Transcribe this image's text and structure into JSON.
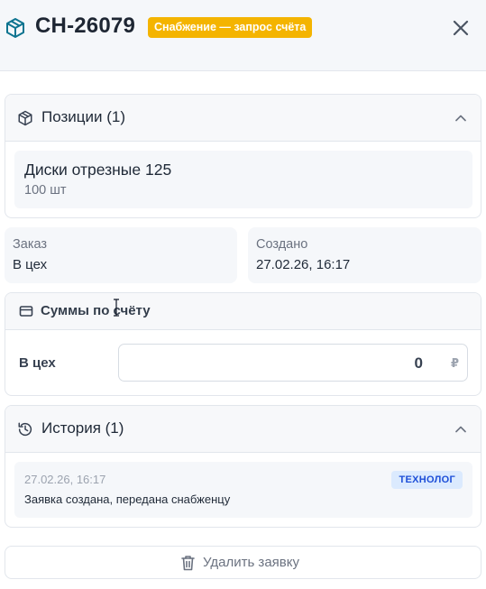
{
  "header": {
    "title": "СН-26079",
    "status_badge": "Снабжение — запрос счёта",
    "badge_color": "#f4b400",
    "icon": "box-icon",
    "close_icon": "close-icon"
  },
  "positions": {
    "title": "Позиции (1)",
    "items": [
      {
        "name": "Диски отрезные 125",
        "qty": "100 шт"
      }
    ]
  },
  "info": {
    "order_label": "Заказ",
    "order_value": "В цех",
    "created_label": "Создано",
    "created_value": "27.02.26, 16:17"
  },
  "sums": {
    "title": "Суммы по счёту",
    "rows": [
      {
        "label": "В цех",
        "value": "0",
        "currency": "₽"
      }
    ]
  },
  "history": {
    "title": "История (1)",
    "items": [
      {
        "time": "27.02.26, 16:17",
        "role": "ТЕХНОЛОГ",
        "text": "Заявка создана, передана снабженцу"
      }
    ]
  },
  "actions": {
    "delete_label": "Удалить заявку"
  }
}
